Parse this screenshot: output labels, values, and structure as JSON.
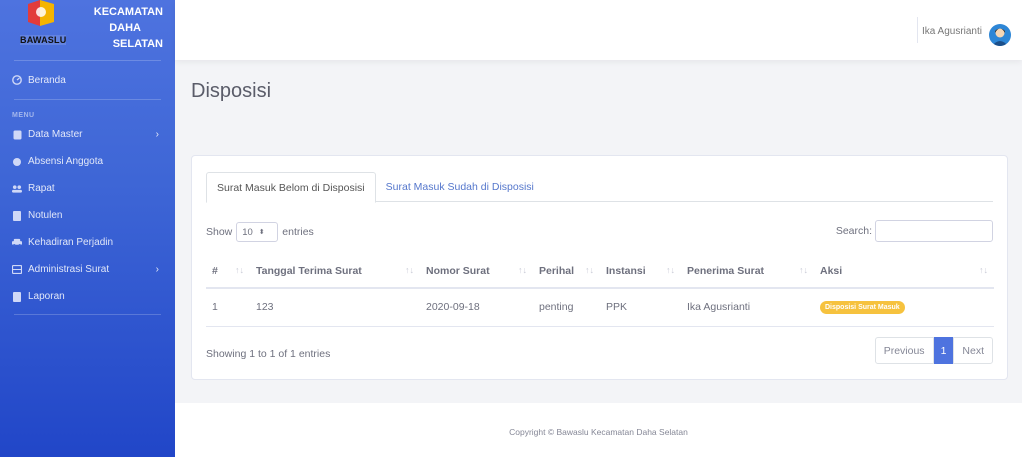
{
  "brand": {
    "line1": "KECAMATAN",
    "line2": "DAHA",
    "line3": "SELATAN",
    "sub": "BAWASLU"
  },
  "sidebar": {
    "dashboard": {
      "label": "Beranda",
      "icon": "dashboard-icon"
    },
    "menu_heading": "MENU",
    "items": [
      {
        "label": "Data Master",
        "icon": "database-icon",
        "has_children": true
      },
      {
        "label": "Absensi Anggota",
        "icon": "fingerprint-icon",
        "has_children": false
      },
      {
        "label": "Rapat",
        "icon": "users-icon",
        "has_children": false
      },
      {
        "label": "Notulen",
        "icon": "file-icon",
        "has_children": false
      },
      {
        "label": "Kehadiran Perjadin",
        "icon": "car-icon",
        "has_children": false
      },
      {
        "label": "Administrasi Surat",
        "icon": "mail-icon",
        "has_children": true
      },
      {
        "label": "Laporan",
        "icon": "file-icon",
        "has_children": false
      }
    ]
  },
  "topbar": {
    "user_name": "Ika Agusrianti"
  },
  "page": {
    "title": "Disposisi"
  },
  "tabs": [
    {
      "label": "Surat Masuk Belom di Disposisi",
      "active": true
    },
    {
      "label": "Surat Masuk Sudah di Disposisi",
      "active": false
    }
  ],
  "table_controls": {
    "show_label": "Show",
    "entries_value": "10",
    "entries_label": "entries",
    "search_label": "Search:"
  },
  "table": {
    "columns": [
      "#",
      "Tanggal Terima Surat",
      "Nomor Surat",
      "Perihal",
      "Instansi",
      "Penerima Surat",
      "Aksi"
    ],
    "rows": [
      {
        "no": "1",
        "tanggal": "123",
        "nomor": "2020-09-18",
        "perihal": "penting",
        "instansi": "PPK",
        "penerima": "Ika Agusrianti",
        "aksi": "Disposisi Surat Masuk"
      }
    ]
  },
  "pagination": {
    "info": "Showing 1 to 1 of 1 entries",
    "previous": "Previous",
    "current": "1",
    "next": "Next"
  },
  "footer": {
    "text": "Copyright © Bawaslu Kecamatan Daha Selatan"
  },
  "colors": {
    "sidebar": "#4e73df",
    "primary": "#4e73df",
    "badge": "#f6c23e"
  }
}
